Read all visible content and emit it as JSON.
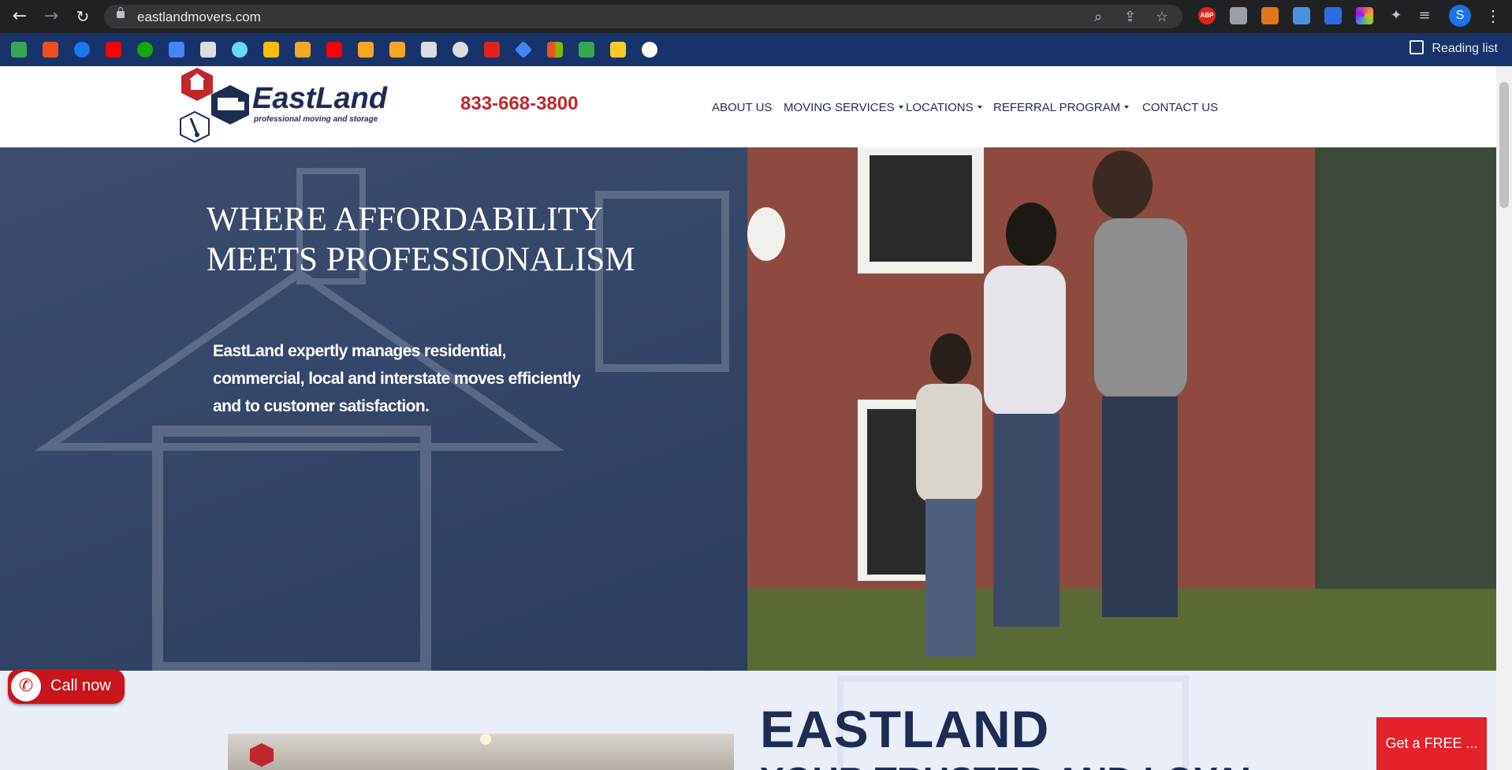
{
  "browser": {
    "url": "eastlandmovers.com",
    "profile_initial": "S",
    "reading_list_label": "Reading list",
    "extensions": [
      {
        "name": "abp-icon",
        "label": "ABP",
        "color": "#e2231a"
      },
      {
        "name": "camera-icon",
        "label": "",
        "color": "#9aa0a6"
      },
      {
        "name": "metamask-icon",
        "label": "",
        "color": "#e2761b"
      },
      {
        "name": "resize-icon",
        "label": "",
        "color": "#4a90e2"
      },
      {
        "name": "h-icon",
        "label": "",
        "color": "#2d6be4"
      },
      {
        "name": "color-wheel-icon",
        "label": "",
        "color": "#e24a8a"
      },
      {
        "name": "puzzle-icon",
        "label": "",
        "color": "#bdc1c6"
      },
      {
        "name": "media-list-icon",
        "label": "",
        "color": "#bdc1c6"
      }
    ],
    "bookmarks": [
      {
        "name": "home-bookmark-icon",
        "color": "#34a853"
      },
      {
        "name": "figma-bookmark-icon",
        "color": "#f24e1e"
      },
      {
        "name": "facebook-bookmark-icon",
        "color": "#1877f2"
      },
      {
        "name": "youtube-bookmark-icon",
        "color": "#ff0000"
      },
      {
        "name": "upwork-bookmark-icon",
        "color": "#14a800"
      },
      {
        "name": "flag-bookmark-icon",
        "color": "#4285f4"
      },
      {
        "name": "cube-bookmark-icon",
        "color": "#dadce0"
      },
      {
        "name": "react-bookmark-icon",
        "color": "#61dafb"
      },
      {
        "name": "drive-bookmark-icon",
        "color": "#fbbc04"
      },
      {
        "name": "star-bookmark-icon",
        "color": "#f5a623"
      },
      {
        "name": "youtube2-bookmark-icon",
        "color": "#ff0000"
      },
      {
        "name": "cap-bookmark-icon",
        "color": "#f5a623"
      },
      {
        "name": "in-bookmark-icon",
        "color": "#f5a623"
      },
      {
        "name": "grid-bookmark-icon",
        "color": "#dadce0"
      },
      {
        "name": "wordpress-bookmark-icon",
        "color": "#dadce0"
      },
      {
        "name": "blocks-bookmark-icon",
        "color": "#e2231a"
      },
      {
        "name": "diamond-bookmark-icon",
        "color": "#4285f4"
      },
      {
        "name": "microsoft-bookmark-icon",
        "color": "#7fba00"
      },
      {
        "name": "chevron-bookmark-icon",
        "color": "#34a853"
      },
      {
        "name": "firebase-bookmark-icon",
        "color": "#ffca28"
      },
      {
        "name": "github-bookmark-icon",
        "color": "#ffffff"
      }
    ]
  },
  "header": {
    "brand_name": "EastLand",
    "tagline": "professional moving and storage",
    "phone": "833-668-3800",
    "menu": [
      {
        "label": "ABOUT US",
        "dropdown": false
      },
      {
        "label": "MOVING SERVICES",
        "dropdown": true
      },
      {
        "label": "LOCATIONS",
        "dropdown": true
      },
      {
        "label": "REFERRAL PROGRAM",
        "dropdown": true
      },
      {
        "label": "CONTACT US",
        "dropdown": false
      }
    ]
  },
  "hero": {
    "title_line1": "WHERE AFFORDABILITY",
    "title_line2": "MEETS PROFESSIONALISM",
    "text_line1": "EastLand expertly manages residential,",
    "text_line2": "commercial, local and interstate moves efficiently",
    "text_line3": "and to customer satisfaction."
  },
  "section2": {
    "title": "EASTLAND",
    "subtitle": "YOUR TRUSTED AND LOYAL"
  },
  "floating": {
    "call_now_label": "Call now",
    "free_button_label": "Get a FREE ..."
  },
  "colors": {
    "chrome_dark": "#202124",
    "bookmarks_bar": "#16346b",
    "brand_red": "#c0272d",
    "navy": "#1c2c52"
  }
}
